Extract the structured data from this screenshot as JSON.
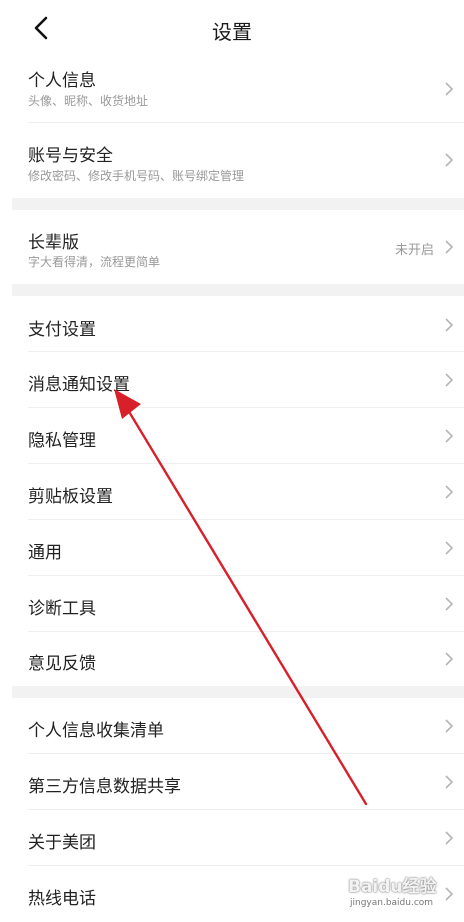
{
  "header": {
    "title": "设置"
  },
  "sections": [
    {
      "items": [
        {
          "label": "个人信息",
          "sub": "头像、昵称、收货地址"
        },
        {
          "label": "账号与安全",
          "sub": "修改密码、修改手机号码、账号绑定管理"
        }
      ]
    },
    {
      "items": [
        {
          "label": "长辈版",
          "sub": "字大看得清，流程更简单",
          "status": "未开启"
        }
      ]
    },
    {
      "items": [
        {
          "label": "支付设置"
        },
        {
          "label": "消息通知设置"
        },
        {
          "label": "隐私管理"
        },
        {
          "label": "剪贴板设置"
        },
        {
          "label": "通用"
        },
        {
          "label": "诊断工具"
        },
        {
          "label": "意见反馈"
        }
      ]
    },
    {
      "items": [
        {
          "label": "个人信息收集清单"
        },
        {
          "label": "第三方信息数据共享"
        },
        {
          "label": "关于美团"
        },
        {
          "label": "热线电话"
        }
      ]
    }
  ],
  "watermark": {
    "brand": "Baidu经验",
    "url": "jingyan.baidu.com"
  },
  "colors": {
    "annotation_arrow": "#d8202a",
    "section_gap": "#f2f2f2"
  }
}
